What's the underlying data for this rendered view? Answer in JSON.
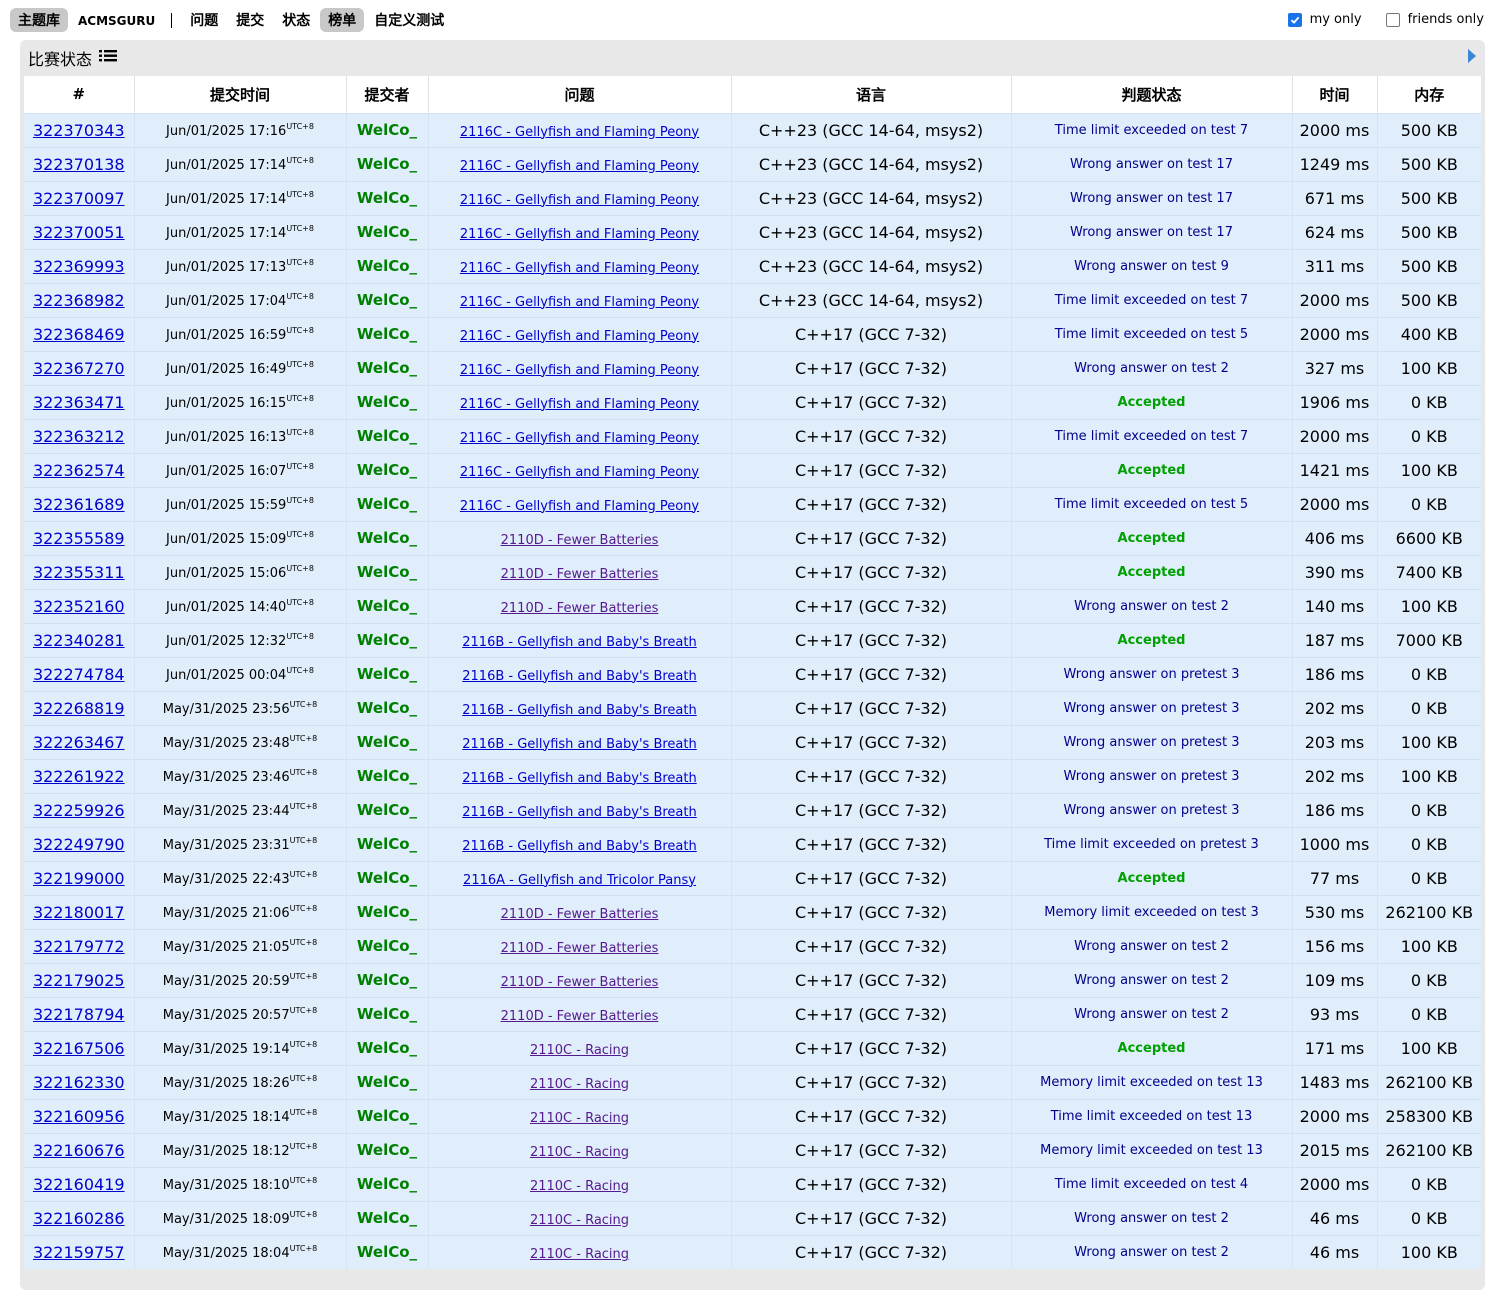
{
  "nav": {
    "items": [
      {
        "label": "主题库",
        "active": true
      },
      {
        "label": "ACMSGURU",
        "active": false
      },
      {
        "label": "问题",
        "active": false
      },
      {
        "label": "提交",
        "active": false
      },
      {
        "label": "状态",
        "active": false
      },
      {
        "label": "榜单",
        "active": true
      },
      {
        "label": "自定义测试",
        "active": false
      }
    ]
  },
  "filters": {
    "my_only": {
      "label": "my only",
      "checked": true
    },
    "friends_only": {
      "label": "friends only",
      "checked": false
    }
  },
  "panel": {
    "title": "比赛状态",
    "title_icon": "list-icon",
    "nav_icon": "play-arrow-icon"
  },
  "colors": {
    "row_bg": "#e0eefc",
    "accepted": "#00a000",
    "verdict": "#00008b",
    "user": "#008000",
    "link": "#0000cc",
    "visited_link": "#551a8b"
  },
  "table": {
    "headers": [
      "#",
      "提交时间",
      "提交者",
      "问题",
      "语言",
      "判题状态",
      "时间",
      "内存"
    ],
    "tz": "UTC+8",
    "rows": [
      {
        "id": "322370343",
        "time": "Jun/01/2025 17:16",
        "user": "WelCo_",
        "problem": "2116C - Gellyfish and Flaming Peony",
        "visited": false,
        "lang": "C++23 (GCC 14-64, msys2)",
        "verdict": "Time limit exceeded on test 7",
        "ok": false,
        "t": "2000 ms",
        "mem": "500 KB"
      },
      {
        "id": "322370138",
        "time": "Jun/01/2025 17:14",
        "user": "WelCo_",
        "problem": "2116C - Gellyfish and Flaming Peony",
        "visited": false,
        "lang": "C++23 (GCC 14-64, msys2)",
        "verdict": "Wrong answer on test 17",
        "ok": false,
        "t": "1249 ms",
        "mem": "500 KB"
      },
      {
        "id": "322370097",
        "time": "Jun/01/2025 17:14",
        "user": "WelCo_",
        "problem": "2116C - Gellyfish and Flaming Peony",
        "visited": false,
        "lang": "C++23 (GCC 14-64, msys2)",
        "verdict": "Wrong answer on test 17",
        "ok": false,
        "t": "671 ms",
        "mem": "500 KB"
      },
      {
        "id": "322370051",
        "time": "Jun/01/2025 17:14",
        "user": "WelCo_",
        "problem": "2116C - Gellyfish and Flaming Peony",
        "visited": false,
        "lang": "C++23 (GCC 14-64, msys2)",
        "verdict": "Wrong answer on test 17",
        "ok": false,
        "t": "624 ms",
        "mem": "500 KB"
      },
      {
        "id": "322369993",
        "time": "Jun/01/2025 17:13",
        "user": "WelCo_",
        "problem": "2116C - Gellyfish and Flaming Peony",
        "visited": false,
        "lang": "C++23 (GCC 14-64, msys2)",
        "verdict": "Wrong answer on test 9",
        "ok": false,
        "t": "311 ms",
        "mem": "500 KB"
      },
      {
        "id": "322368982",
        "time": "Jun/01/2025 17:04",
        "user": "WelCo_",
        "problem": "2116C - Gellyfish and Flaming Peony",
        "visited": false,
        "lang": "C++23 (GCC 14-64, msys2)",
        "verdict": "Time limit exceeded on test 7",
        "ok": false,
        "t": "2000 ms",
        "mem": "500 KB"
      },
      {
        "id": "322368469",
        "time": "Jun/01/2025 16:59",
        "user": "WelCo_",
        "problem": "2116C - Gellyfish and Flaming Peony",
        "visited": false,
        "lang": "C++17 (GCC 7-32)",
        "verdict": "Time limit exceeded on test 5",
        "ok": false,
        "t": "2000 ms",
        "mem": "400 KB"
      },
      {
        "id": "322367270",
        "time": "Jun/01/2025 16:49",
        "user": "WelCo_",
        "problem": "2116C - Gellyfish and Flaming Peony",
        "visited": false,
        "lang": "C++17 (GCC 7-32)",
        "verdict": "Wrong answer on test 2",
        "ok": false,
        "t": "327 ms",
        "mem": "100 KB"
      },
      {
        "id": "322363471",
        "time": "Jun/01/2025 16:15",
        "user": "WelCo_",
        "problem": "2116C - Gellyfish and Flaming Peony",
        "visited": false,
        "lang": "C++17 (GCC 7-32)",
        "verdict": "Accepted",
        "ok": true,
        "t": "1906 ms",
        "mem": "0 KB"
      },
      {
        "id": "322363212",
        "time": "Jun/01/2025 16:13",
        "user": "WelCo_",
        "problem": "2116C - Gellyfish and Flaming Peony",
        "visited": false,
        "lang": "C++17 (GCC 7-32)",
        "verdict": "Time limit exceeded on test 7",
        "ok": false,
        "t": "2000 ms",
        "mem": "0 KB"
      },
      {
        "id": "322362574",
        "time": "Jun/01/2025 16:07",
        "user": "WelCo_",
        "problem": "2116C - Gellyfish and Flaming Peony",
        "visited": false,
        "lang": "C++17 (GCC 7-32)",
        "verdict": "Accepted",
        "ok": true,
        "t": "1421 ms",
        "mem": "100 KB"
      },
      {
        "id": "322361689",
        "time": "Jun/01/2025 15:59",
        "user": "WelCo_",
        "problem": "2116C - Gellyfish and Flaming Peony",
        "visited": false,
        "lang": "C++17 (GCC 7-32)",
        "verdict": "Time limit exceeded on test 5",
        "ok": false,
        "t": "2000 ms",
        "mem": "0 KB"
      },
      {
        "id": "322355589",
        "time": "Jun/01/2025 15:09",
        "user": "WelCo_",
        "problem": "2110D - Fewer Batteries",
        "visited": true,
        "lang": "C++17 (GCC 7-32)",
        "verdict": "Accepted",
        "ok": true,
        "t": "406 ms",
        "mem": "6600 KB"
      },
      {
        "id": "322355311",
        "time": "Jun/01/2025 15:06",
        "user": "WelCo_",
        "problem": "2110D - Fewer Batteries",
        "visited": true,
        "lang": "C++17 (GCC 7-32)",
        "verdict": "Accepted",
        "ok": true,
        "t": "390 ms",
        "mem": "7400 KB"
      },
      {
        "id": "322352160",
        "time": "Jun/01/2025 14:40",
        "user": "WelCo_",
        "problem": "2110D - Fewer Batteries",
        "visited": true,
        "lang": "C++17 (GCC 7-32)",
        "verdict": "Wrong answer on test 2",
        "ok": false,
        "t": "140 ms",
        "mem": "100 KB"
      },
      {
        "id": "322340281",
        "time": "Jun/01/2025 12:32",
        "user": "WelCo_",
        "problem": "2116B - Gellyfish and Baby's Breath",
        "visited": false,
        "lang": "C++17 (GCC 7-32)",
        "verdict": "Accepted",
        "ok": true,
        "t": "187 ms",
        "mem": "7000 KB"
      },
      {
        "id": "322274784",
        "time": "Jun/01/2025 00:04",
        "user": "WelCo_",
        "problem": "2116B - Gellyfish and Baby's Breath",
        "visited": false,
        "lang": "C++17 (GCC 7-32)",
        "verdict": "Wrong answer on pretest 3",
        "ok": false,
        "t": "186 ms",
        "mem": "0 KB"
      },
      {
        "id": "322268819",
        "time": "May/31/2025 23:56",
        "user": "WelCo_",
        "problem": "2116B - Gellyfish and Baby's Breath",
        "visited": false,
        "lang": "C++17 (GCC 7-32)",
        "verdict": "Wrong answer on pretest 3",
        "ok": false,
        "t": "202 ms",
        "mem": "0 KB"
      },
      {
        "id": "322263467",
        "time": "May/31/2025 23:48",
        "user": "WelCo_",
        "problem": "2116B - Gellyfish and Baby's Breath",
        "visited": false,
        "lang": "C++17 (GCC 7-32)",
        "verdict": "Wrong answer on pretest 3",
        "ok": false,
        "t": "203 ms",
        "mem": "100 KB"
      },
      {
        "id": "322261922",
        "time": "May/31/2025 23:46",
        "user": "WelCo_",
        "problem": "2116B - Gellyfish and Baby's Breath",
        "visited": false,
        "lang": "C++17 (GCC 7-32)",
        "verdict": "Wrong answer on pretest 3",
        "ok": false,
        "t": "202 ms",
        "mem": "100 KB"
      },
      {
        "id": "322259926",
        "time": "May/31/2025 23:44",
        "user": "WelCo_",
        "problem": "2116B - Gellyfish and Baby's Breath",
        "visited": false,
        "lang": "C++17 (GCC 7-32)",
        "verdict": "Wrong answer on pretest 3",
        "ok": false,
        "t": "186 ms",
        "mem": "0 KB"
      },
      {
        "id": "322249790",
        "time": "May/31/2025 23:31",
        "user": "WelCo_",
        "problem": "2116B - Gellyfish and Baby's Breath",
        "visited": false,
        "lang": "C++17 (GCC 7-32)",
        "verdict": "Time limit exceeded on pretest 3",
        "ok": false,
        "t": "1000 ms",
        "mem": "0 KB"
      },
      {
        "id": "322199000",
        "time": "May/31/2025 22:43",
        "user": "WelCo_",
        "problem": "2116A - Gellyfish and Tricolor Pansy",
        "visited": false,
        "lang": "C++17 (GCC 7-32)",
        "verdict": "Accepted",
        "ok": true,
        "t": "77 ms",
        "mem": "0 KB"
      },
      {
        "id": "322180017",
        "time": "May/31/2025 21:06",
        "user": "WelCo_",
        "problem": "2110D - Fewer Batteries",
        "visited": true,
        "lang": "C++17 (GCC 7-32)",
        "verdict": "Memory limit exceeded on test 3",
        "ok": false,
        "t": "530 ms",
        "mem": "262100 KB"
      },
      {
        "id": "322179772",
        "time": "May/31/2025 21:05",
        "user": "WelCo_",
        "problem": "2110D - Fewer Batteries",
        "visited": true,
        "lang": "C++17 (GCC 7-32)",
        "verdict": "Wrong answer on test 2",
        "ok": false,
        "t": "156 ms",
        "mem": "100 KB"
      },
      {
        "id": "322179025",
        "time": "May/31/2025 20:59",
        "user": "WelCo_",
        "problem": "2110D - Fewer Batteries",
        "visited": true,
        "lang": "C++17 (GCC 7-32)",
        "verdict": "Wrong answer on test 2",
        "ok": false,
        "t": "109 ms",
        "mem": "0 KB"
      },
      {
        "id": "322178794",
        "time": "May/31/2025 20:57",
        "user": "WelCo_",
        "problem": "2110D - Fewer Batteries",
        "visited": true,
        "lang": "C++17 (GCC 7-32)",
        "verdict": "Wrong answer on test 2",
        "ok": false,
        "t": "93 ms",
        "mem": "0 KB"
      },
      {
        "id": "322167506",
        "time": "May/31/2025 19:14",
        "user": "WelCo_",
        "problem": "2110C - Racing",
        "visited": true,
        "lang": "C++17 (GCC 7-32)",
        "verdict": "Accepted",
        "ok": true,
        "t": "171 ms",
        "mem": "100 KB"
      },
      {
        "id": "322162330",
        "time": "May/31/2025 18:26",
        "user": "WelCo_",
        "problem": "2110C - Racing",
        "visited": true,
        "lang": "C++17 (GCC 7-32)",
        "verdict": "Memory limit exceeded on test 13",
        "ok": false,
        "t": "1483 ms",
        "mem": "262100 KB"
      },
      {
        "id": "322160956",
        "time": "May/31/2025 18:14",
        "user": "WelCo_",
        "problem": "2110C - Racing",
        "visited": true,
        "lang": "C++17 (GCC 7-32)",
        "verdict": "Time limit exceeded on test 13",
        "ok": false,
        "t": "2000 ms",
        "mem": "258300 KB"
      },
      {
        "id": "322160676",
        "time": "May/31/2025 18:12",
        "user": "WelCo_",
        "problem": "2110C - Racing",
        "visited": true,
        "lang": "C++17 (GCC 7-32)",
        "verdict": "Memory limit exceeded on test 13",
        "ok": false,
        "t": "2015 ms",
        "mem": "262100 KB"
      },
      {
        "id": "322160419",
        "time": "May/31/2025 18:10",
        "user": "WelCo_",
        "problem": "2110C - Racing",
        "visited": true,
        "lang": "C++17 (GCC 7-32)",
        "verdict": "Time limit exceeded on test 4",
        "ok": false,
        "t": "2000 ms",
        "mem": "0 KB"
      },
      {
        "id": "322160286",
        "time": "May/31/2025 18:09",
        "user": "WelCo_",
        "problem": "2110C - Racing",
        "visited": true,
        "lang": "C++17 (GCC 7-32)",
        "verdict": "Wrong answer on test 2",
        "ok": false,
        "t": "46 ms",
        "mem": "0 KB"
      },
      {
        "id": "322159757",
        "time": "May/31/2025 18:04",
        "user": "WelCo_",
        "problem": "2110C - Racing",
        "visited": true,
        "lang": "C++17 (GCC 7-32)",
        "verdict": "Wrong answer on test 2",
        "ok": false,
        "t": "46 ms",
        "mem": "100 KB"
      }
    ]
  }
}
